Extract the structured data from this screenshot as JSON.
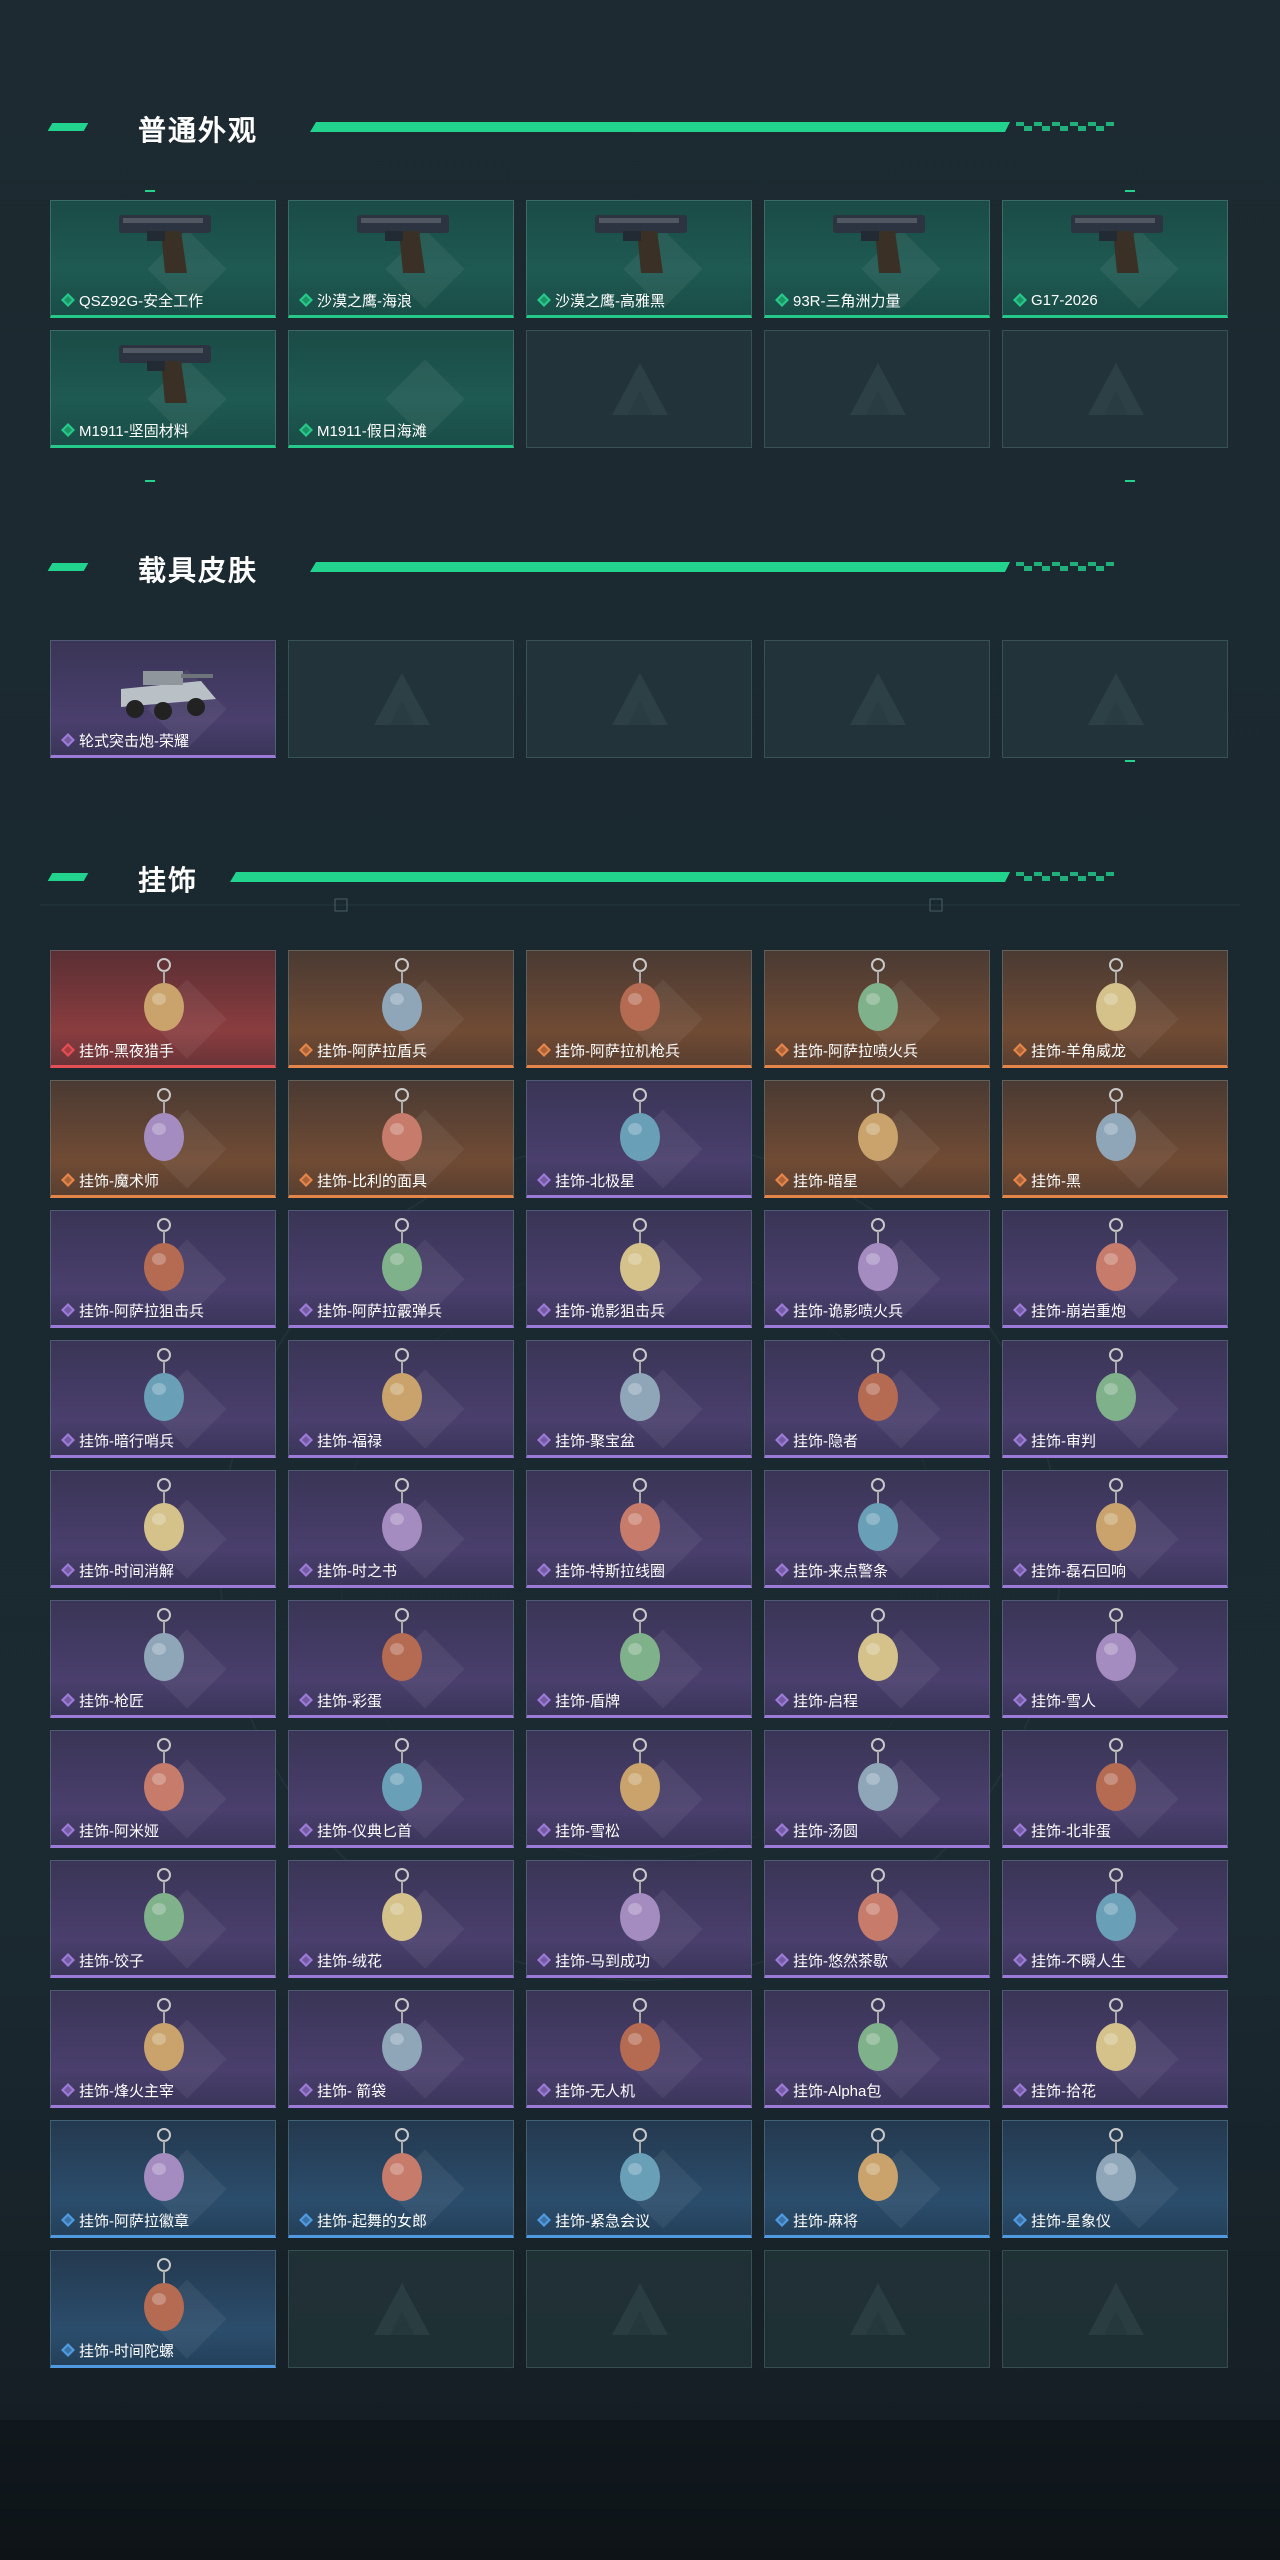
{
  "colors": {
    "accent": "#22d38e",
    "rarity_green": "#26c98a",
    "rarity_purple": "#9b7ad8",
    "rarity_orange": "#e6854a",
    "rarity_red": "#e34f55",
    "rarity_blue": "#4f9ae0"
  },
  "sections": [
    {
      "title": "普通外观",
      "items": [
        {
          "label": "QSZ92G-安全工作",
          "rarity": "green",
          "icon": "pistol-icon"
        },
        {
          "label": "沙漠之鹰-海浪",
          "rarity": "green",
          "icon": "pistol-icon"
        },
        {
          "label": "沙漠之鹰-高雅黑",
          "rarity": "green",
          "icon": "pistol-icon"
        },
        {
          "label": "93R-三角洲力量",
          "rarity": "green",
          "icon": "pistol-icon"
        },
        {
          "label": "G17-2026",
          "rarity": "green",
          "icon": "pistol-icon"
        },
        {
          "label": "M1911-坚固材料",
          "rarity": "green",
          "icon": "pistol-icon"
        },
        {
          "label": "M1911-假日海滩",
          "rarity": "green",
          "icon": ""
        },
        {
          "label": "",
          "rarity": "empty",
          "icon": ""
        },
        {
          "label": "",
          "rarity": "empty",
          "icon": ""
        },
        {
          "label": "",
          "rarity": "empty",
          "icon": ""
        }
      ]
    },
    {
      "title": "载具皮肤",
      "items": [
        {
          "label": "轮式突击炮-荣耀",
          "rarity": "purple",
          "icon": "vehicle-icon"
        },
        {
          "label": "",
          "rarity": "empty",
          "icon": ""
        },
        {
          "label": "",
          "rarity": "empty",
          "icon": ""
        },
        {
          "label": "",
          "rarity": "empty",
          "icon": ""
        },
        {
          "label": "",
          "rarity": "empty",
          "icon": ""
        }
      ]
    },
    {
      "title": "挂饰",
      "items": [
        {
          "label": "挂饰-黑夜猎手",
          "rarity": "red",
          "icon": "charm-icon"
        },
        {
          "label": "挂饰-阿萨拉盾兵",
          "rarity": "orange",
          "icon": "charm-icon"
        },
        {
          "label": "挂饰-阿萨拉机枪兵",
          "rarity": "orange",
          "icon": "charm-icon"
        },
        {
          "label": "挂饰-阿萨拉喷火兵",
          "rarity": "orange",
          "icon": "charm-icon"
        },
        {
          "label": "挂饰-羊角威龙",
          "rarity": "orange",
          "icon": "charm-icon"
        },
        {
          "label": "挂饰-魔术师",
          "rarity": "orange",
          "icon": "charm-icon"
        },
        {
          "label": "挂饰-比利的面具",
          "rarity": "orange",
          "icon": "charm-icon"
        },
        {
          "label": "挂饰-北极星",
          "rarity": "purple",
          "icon": "charm-icon"
        },
        {
          "label": "挂饰-暗星",
          "rarity": "orange",
          "icon": "charm-icon"
        },
        {
          "label": "挂饰-黑",
          "rarity": "orange",
          "icon": "charm-icon"
        },
        {
          "label": "挂饰-阿萨拉狙击兵",
          "rarity": "purple",
          "icon": "charm-icon"
        },
        {
          "label": "挂饰-阿萨拉霰弹兵",
          "rarity": "purple",
          "icon": "charm-icon"
        },
        {
          "label": "挂饰-诡影狙击兵",
          "rarity": "purple",
          "icon": "charm-icon"
        },
        {
          "label": "挂饰-诡影喷火兵",
          "rarity": "purple",
          "icon": "charm-icon"
        },
        {
          "label": "挂饰-崩岩重炮",
          "rarity": "purple",
          "icon": "charm-icon"
        },
        {
          "label": "挂饰-暗行哨兵",
          "rarity": "purple",
          "icon": "charm-icon"
        },
        {
          "label": "挂饰-福禄",
          "rarity": "purple",
          "icon": "charm-icon"
        },
        {
          "label": "挂饰-聚宝盆",
          "rarity": "purple",
          "icon": "charm-icon"
        },
        {
          "label": "挂饰-隐者",
          "rarity": "purple",
          "icon": "charm-icon"
        },
        {
          "label": "挂饰-审判",
          "rarity": "purple",
          "icon": "charm-icon"
        },
        {
          "label": "挂饰-时间消解",
          "rarity": "purple",
          "icon": "charm-icon"
        },
        {
          "label": "挂饰-时之书",
          "rarity": "purple",
          "icon": "charm-icon"
        },
        {
          "label": "挂饰-特斯拉线圈",
          "rarity": "purple",
          "icon": "charm-icon"
        },
        {
          "label": "挂饰-来点警条",
          "rarity": "purple",
          "icon": "charm-icon"
        },
        {
          "label": "挂饰-磊石回响",
          "rarity": "purple",
          "icon": "charm-icon"
        },
        {
          "label": "挂饰-枪匠",
          "rarity": "purple",
          "icon": "charm-icon"
        },
        {
          "label": "挂饰-彩蛋",
          "rarity": "purple",
          "icon": "charm-icon"
        },
        {
          "label": "挂饰-盾牌",
          "rarity": "purple",
          "icon": "charm-icon"
        },
        {
          "label": "挂饰-启程",
          "rarity": "purple",
          "icon": "charm-icon"
        },
        {
          "label": "挂饰-雪人",
          "rarity": "purple",
          "icon": "charm-icon"
        },
        {
          "label": "挂饰-阿米娅",
          "rarity": "purple",
          "icon": "charm-icon"
        },
        {
          "label": "挂饰-仪典匕首",
          "rarity": "purple",
          "icon": "charm-icon"
        },
        {
          "label": "挂饰-雪松",
          "rarity": "purple",
          "icon": "charm-icon"
        },
        {
          "label": "挂饰-汤圆",
          "rarity": "purple",
          "icon": "charm-icon"
        },
        {
          "label": "挂饰-北非蛋",
          "rarity": "purple",
          "icon": "charm-icon"
        },
        {
          "label": "挂饰-饺子",
          "rarity": "purple",
          "icon": "charm-icon"
        },
        {
          "label": "挂饰-绒花",
          "rarity": "purple",
          "icon": "charm-icon"
        },
        {
          "label": "挂饰-马到成功",
          "rarity": "purple",
          "icon": "charm-icon"
        },
        {
          "label": "挂饰-悠然茶歇",
          "rarity": "purple",
          "icon": "charm-icon"
        },
        {
          "label": "挂饰-不瞬人生",
          "rarity": "purple",
          "icon": "charm-icon"
        },
        {
          "label": "挂饰-烽火主宰",
          "rarity": "purple",
          "icon": "charm-icon"
        },
        {
          "label": "挂饰- 箭袋",
          "rarity": "purple",
          "icon": "charm-icon"
        },
        {
          "label": "挂饰-无人机",
          "rarity": "purple",
          "icon": "charm-icon"
        },
        {
          "label": "挂饰-Alpha包",
          "rarity": "purple",
          "icon": "charm-icon"
        },
        {
          "label": "挂饰-拾花",
          "rarity": "purple",
          "icon": "charm-icon"
        },
        {
          "label": "挂饰-阿萨拉徽章",
          "rarity": "blue",
          "icon": "charm-icon"
        },
        {
          "label": "挂饰-起舞的女郎",
          "rarity": "blue",
          "icon": "charm-icon"
        },
        {
          "label": "挂饰-紧急会议",
          "rarity": "blue",
          "icon": "charm-icon"
        },
        {
          "label": "挂饰-麻将",
          "rarity": "blue",
          "icon": "charm-icon"
        },
        {
          "label": "挂饰-星象仪",
          "rarity": "blue",
          "icon": "charm-icon"
        },
        {
          "label": "挂饰-时间陀螺",
          "rarity": "blue",
          "icon": "charm-icon"
        },
        {
          "label": "",
          "rarity": "empty",
          "icon": ""
        },
        {
          "label": "",
          "rarity": "empty",
          "icon": ""
        },
        {
          "label": "",
          "rarity": "empty",
          "icon": ""
        },
        {
          "label": "",
          "rarity": "empty",
          "icon": ""
        }
      ]
    }
  ]
}
